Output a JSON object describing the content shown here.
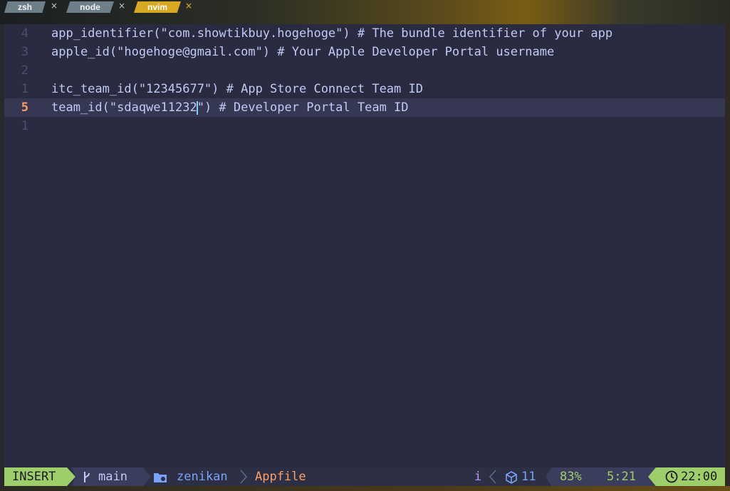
{
  "tabs": [
    {
      "label": "zsh",
      "active": false
    },
    {
      "label": "node",
      "active": false
    },
    {
      "label": "nvim",
      "active": true
    }
  ],
  "tab_close_glyph": "×",
  "editor": {
    "lines": [
      {
        "number": "4",
        "text": "app_identifier(\"com.showtikbuy.hogehoge\") # The bundle identifier of your app",
        "current": false
      },
      {
        "number": "3",
        "text": "apple_id(\"hogehoge@gmail.com\") # Your Apple Developer Portal username",
        "current": false
      },
      {
        "number": "2",
        "text": "",
        "current": false
      },
      {
        "number": "1",
        "text": "itc_team_id(\"12345677\") # App Store Connect Team ID",
        "current": false
      },
      {
        "number": "5",
        "text_before_cursor": "team_id(\"sdaqwe11232",
        "text_after_cursor": "\") # Developer Portal Team ID",
        "current": true
      },
      {
        "number": "1",
        "text": "",
        "current": false
      }
    ]
  },
  "statusline": {
    "mode": "INSERT",
    "branch": "main",
    "directory": "zenikan",
    "file": "Appfile",
    "indicator": "i",
    "lsp_count": "11",
    "percent": "83%",
    "position": "5:21",
    "time": "22:00",
    "colors": {
      "mode_bg": "#9ece6a",
      "file": "#ff9e64",
      "dir": "#7aa2f7"
    }
  },
  "icons": [
    "git-branch-icon",
    "folder-icon",
    "package-icon",
    "clock-icon",
    "chevron-left-icon",
    "chevron-right-icon"
  ]
}
